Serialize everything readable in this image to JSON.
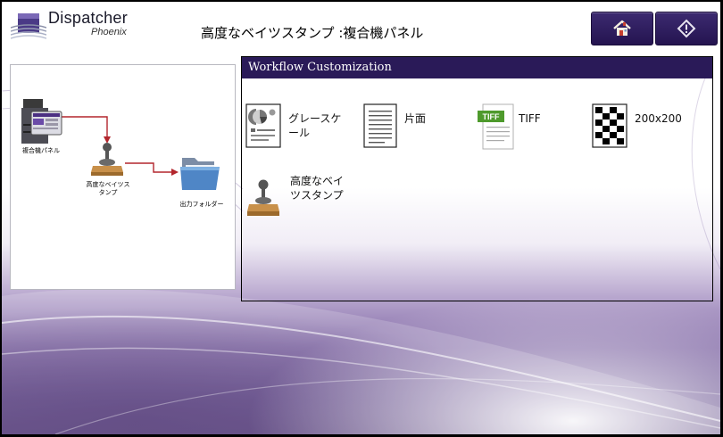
{
  "header": {
    "logo_title": "Dispatcher",
    "logo_subtitle": "Phoenix",
    "page_title": "高度なベイツスタンプ :複合機パネル",
    "home_icon": "home-icon",
    "start_icon": "start-diamond-icon"
  },
  "diagram": {
    "nodes": [
      {
        "label": "複合機パネル",
        "icon": "mfp-printer-icon"
      },
      {
        "label": "高度なベイツス\nタンプ",
        "icon": "bates-stamp-icon"
      },
      {
        "label": "出力フォルダー",
        "icon": "folder-icon"
      }
    ]
  },
  "workflow": {
    "title": "Workflow Customization",
    "items": [
      {
        "label": "グレースケ\nール",
        "icon": "grayscale-document-icon"
      },
      {
        "label": "片面",
        "icon": "single-sided-page-icon"
      },
      {
        "label": "TIFF",
        "icon": "tiff-file-icon"
      },
      {
        "label": "200x200",
        "icon": "resolution-checker-icon"
      },
      {
        "label": "高度なベイ\nツスタンプ",
        "icon": "bates-stamp-icon"
      }
    ]
  },
  "colors": {
    "accent": "#2a1a58",
    "button": "#3c2a70",
    "arrow": "#b3262d"
  }
}
